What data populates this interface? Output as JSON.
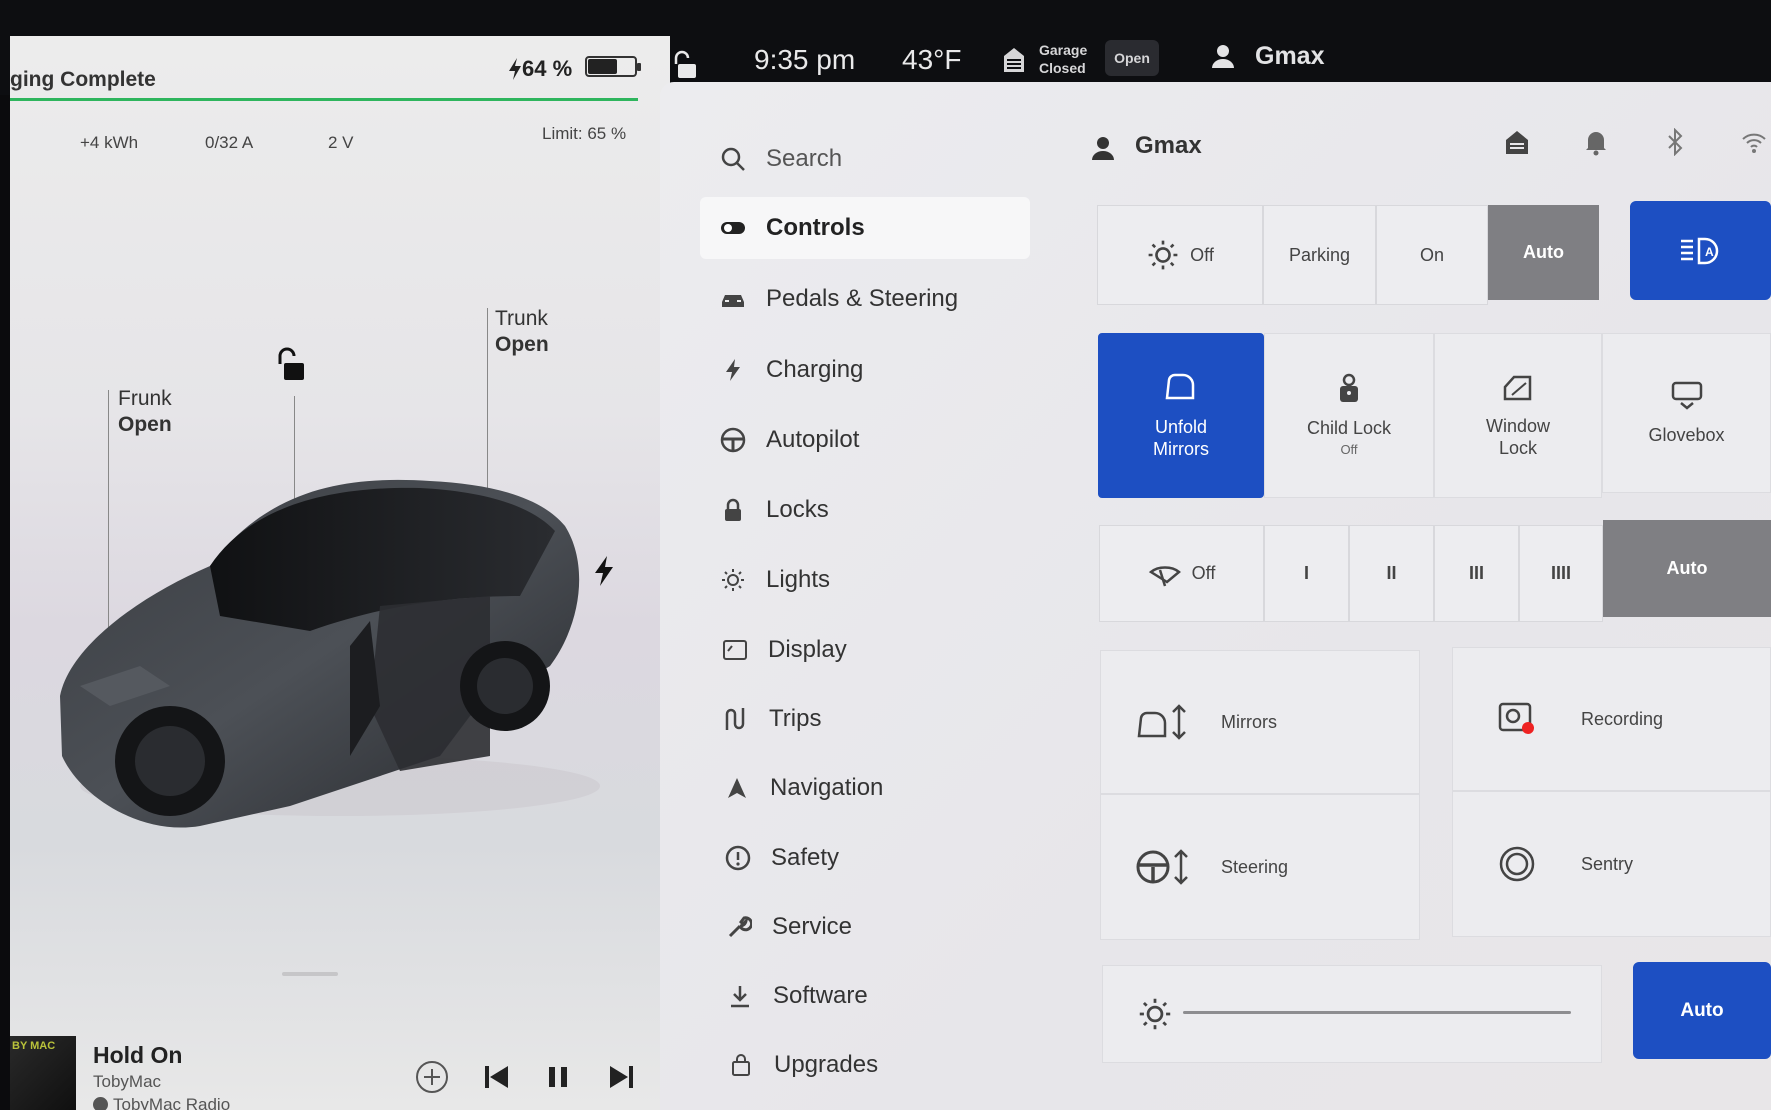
{
  "topbar": {
    "time": "9:35 pm",
    "temperature": "43°F",
    "garage_line1": "Garage",
    "garage_line2": "Closed",
    "garage_button": "Open",
    "user": "Gmax"
  },
  "charging": {
    "status": "ging Complete",
    "battery_percent": "64 %",
    "battery_level": 0.64,
    "energy_added": "+4 kWh",
    "current": "0/32 A",
    "voltage": "2 V",
    "limit": "Limit: 65 %",
    "accent_color": "#2eb55d"
  },
  "car": {
    "frunk_label": "Frunk",
    "frunk_state": "Open",
    "trunk_label": "Trunk",
    "trunk_state": "Open"
  },
  "media": {
    "album_text": "BY MAC",
    "song": "Hold On",
    "artist": "TobyMac",
    "station": "TobyMac Radio"
  },
  "nav": {
    "items": [
      {
        "label": "Search",
        "icon": "search-icon"
      },
      {
        "label": "Controls",
        "icon": "toggle-icon",
        "active": true
      },
      {
        "label": "Pedals & Steering",
        "icon": "car-icon"
      },
      {
        "label": "Charging",
        "icon": "bolt-icon"
      },
      {
        "label": "Autopilot",
        "icon": "steering-wheel-icon"
      },
      {
        "label": "Locks",
        "icon": "lock-icon"
      },
      {
        "label": "Lights",
        "icon": "sun-icon"
      },
      {
        "label": "Display",
        "icon": "display-icon"
      },
      {
        "label": "Trips",
        "icon": "trips-icon"
      },
      {
        "label": "Navigation",
        "icon": "navigation-arrow-icon"
      },
      {
        "label": "Safety",
        "icon": "alert-circle-icon"
      },
      {
        "label": "Service",
        "icon": "wrench-icon"
      },
      {
        "label": "Software",
        "icon": "download-icon"
      },
      {
        "label": "Upgrades",
        "icon": "bag-icon"
      }
    ]
  },
  "controls": {
    "profile_name": "Gmax",
    "headlights": {
      "off": "Off",
      "parking": "Parking",
      "on": "On",
      "auto": "Auto",
      "selected": "Auto"
    },
    "tiles": {
      "unfold_mirrors_1": "Unfold",
      "unfold_mirrors_2": "Mirrors",
      "child_lock": "Child Lock",
      "child_lock_state": "Off",
      "window_lock_1": "Window",
      "window_lock_2": "Lock",
      "glovebox": "Glovebox"
    },
    "wipers": {
      "off": "Off",
      "s1": "I",
      "s2": "II",
      "s3": "III",
      "s4": "IIII",
      "auto": "Auto",
      "selected": "Auto"
    },
    "mirrors": "Mirrors",
    "recording": "Recording",
    "steering": "Steering",
    "sentry": "Sentry",
    "brightness_auto": "Auto",
    "accent_color": "#1d4fc2"
  }
}
